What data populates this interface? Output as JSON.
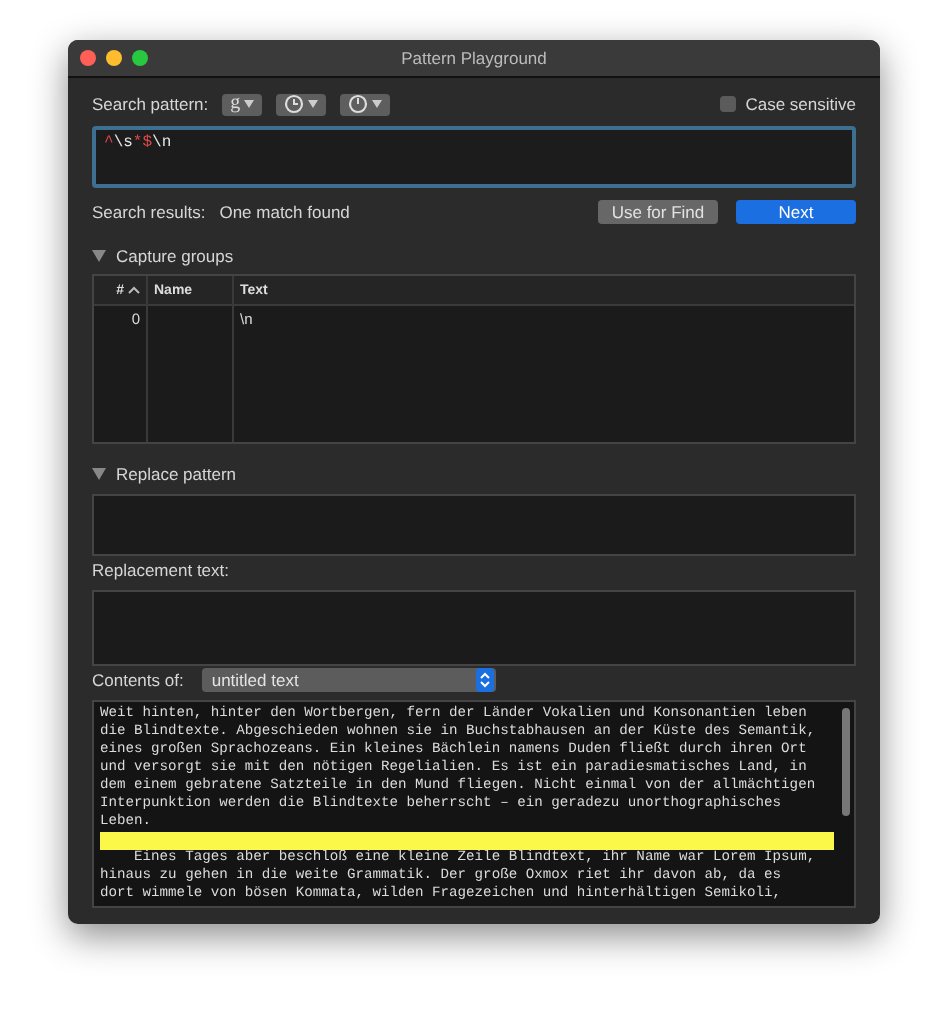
{
  "window": {
    "title": "Pattern Playground"
  },
  "search_pattern": {
    "label": "Search pattern:",
    "syntax_popup": "g",
    "case_sensitive": {
      "label": "Case sensitive",
      "checked": false
    },
    "tokens": [
      {
        "text": "^",
        "kind": "operator"
      },
      {
        "text": "\\s",
        "kind": "literal"
      },
      {
        "text": "*$",
        "kind": "operator"
      },
      {
        "text": "\\n",
        "kind": "literal"
      }
    ]
  },
  "search_results": {
    "label": "Search results:",
    "value": "One match found",
    "buttons": [
      {
        "label": "Use for Find",
        "kind": "secondary"
      },
      {
        "label": "Next",
        "kind": "primary"
      }
    ]
  },
  "capture_groups": {
    "label": "Capture groups",
    "expanded": true,
    "columns": [
      "#",
      "Name",
      "Text"
    ],
    "rows": [
      {
        "number": "0",
        "text": "\\n"
      }
    ]
  },
  "replace_pattern": {
    "label": "Replace pattern",
    "expanded": true
  },
  "replacement_text": {
    "label": "Replacement text:"
  },
  "contents": {
    "label": "Contents of:",
    "source": "untitled text",
    "lines": [
      {
        "kind": "text",
        "text": "Weit hinten, hinter den Wortbergen, fern der Länder Vokalien und Konsonantien leben"
      },
      {
        "kind": "text",
        "text": "die Blindtexte. Abgeschieden wohnen sie in Buchstabhausen an der Küste des Semantik,"
      },
      {
        "kind": "text",
        "text": "eines großen Sprachozeans. Ein kleines Bächlein namens Duden fließt durch ihren Ort"
      },
      {
        "kind": "text",
        "text": "und versorgt sie mit den nötigen Regelialien. Es ist ein paradiesmatisches Land, in"
      },
      {
        "kind": "text",
        "text": "dem einem gebratene Satzteile in den Mund fliegen. Nicht einmal von der allmächtigen"
      },
      {
        "kind": "text",
        "text": "Interpunktion werden die Blindtexte beherrscht – ein geradezu unorthographisches"
      },
      {
        "kind": "text",
        "text": "Leben."
      },
      {
        "kind": "match"
      },
      {
        "kind": "text",
        "text": "    Eines Tages aber beschloß eine kleine Zeile Blindtext, ihr Name war Lorem Ipsum,"
      },
      {
        "kind": "text",
        "text": "hinaus zu gehen in die weite Grammatik. Der große Oxmox riet ihr davon ab, da es"
      },
      {
        "kind": "text",
        "text": "dort wimmele von bösen Kommata, wilden Fragezeichen und hinterhältigen Semikoli,"
      }
    ]
  }
}
